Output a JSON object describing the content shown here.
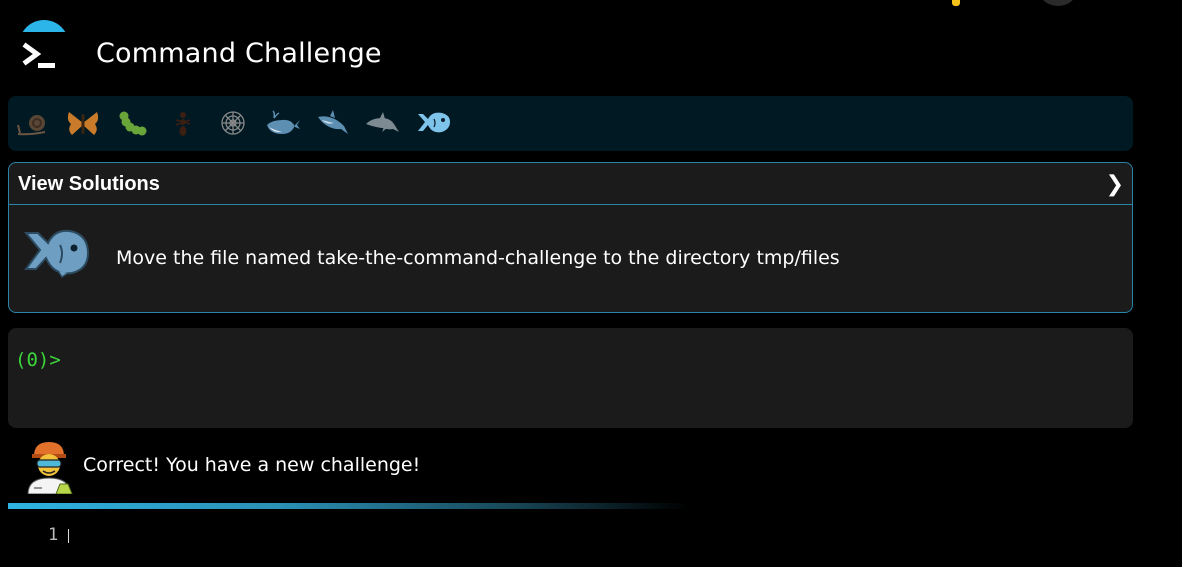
{
  "header": {
    "title": "Command Challenge",
    "logo_icon": "terminal-prompt-icon",
    "accent_color": "#2bb5e8"
  },
  "levels": [
    {
      "icon": "snail-icon",
      "state": "completed"
    },
    {
      "icon": "butterfly-icon",
      "state": "completed"
    },
    {
      "icon": "caterpillar-icon",
      "state": "completed"
    },
    {
      "icon": "ant-icon",
      "state": "completed"
    },
    {
      "icon": "spider-web-icon",
      "state": "completed"
    },
    {
      "icon": "whale-icon",
      "state": "completed"
    },
    {
      "icon": "shark-icon",
      "state": "completed"
    },
    {
      "icon": "dolphin-icon",
      "state": "completed"
    },
    {
      "icon": "fish-icon",
      "state": "current"
    }
  ],
  "solutions": {
    "label": "View Solutions",
    "chevron": "❯",
    "border_color": "#2a83a8"
  },
  "challenge": {
    "icon": "fish-icon",
    "text": "Move the file named take-the-command-challenge to the directory tmp/files"
  },
  "terminal": {
    "prompt": "(0)>",
    "prompt_color": "#3ad53a"
  },
  "feedback": {
    "avatar_icon": "scientist-avatar-icon",
    "message": "Correct! You have a new challenge!"
  },
  "editor": {
    "line_number": "1"
  }
}
